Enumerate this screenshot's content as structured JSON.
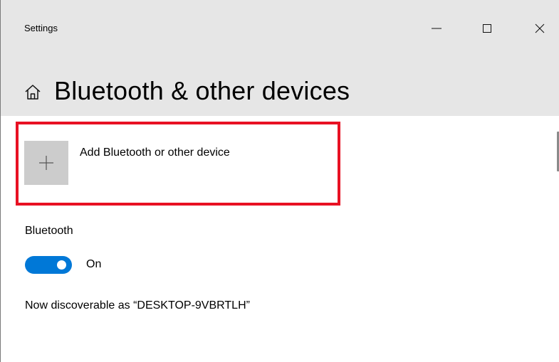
{
  "window": {
    "title": "Settings"
  },
  "titlebar_controls": {
    "minimize_icon": "minimize-icon",
    "maximize_icon": "maximize-icon",
    "close_icon": "close-icon"
  },
  "header": {
    "home_icon": "home-icon",
    "title": "Bluetooth & other devices"
  },
  "add_device": {
    "icon": "plus-icon",
    "label": "Add Bluetooth or other device"
  },
  "bluetooth": {
    "section_label": "Bluetooth",
    "toggle_state": "On",
    "discoverable_text": "Now discoverable as “DESKTOP-9VBRTLH”"
  },
  "colors": {
    "accent": "#0078d7",
    "highlight": "#e81123",
    "header_background": "#e6e6e6",
    "tile_background": "#cccccc"
  }
}
